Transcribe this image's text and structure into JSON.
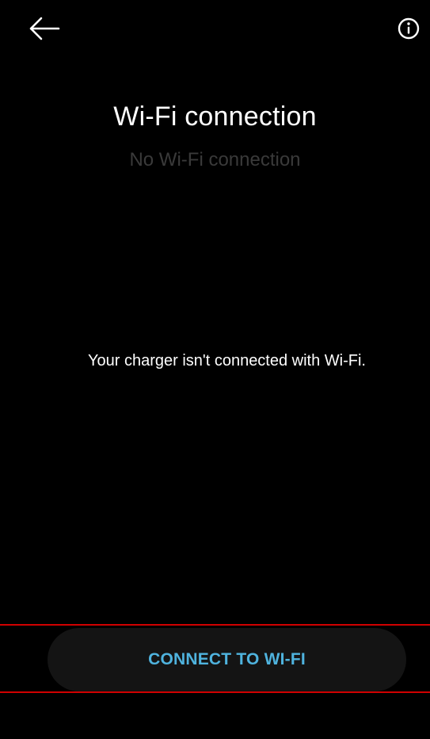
{
  "header": {
    "back_icon": "arrow-left-icon",
    "info_icon": "info-circle-icon"
  },
  "main": {
    "title": "Wi-Fi connection",
    "subtitle": "No Wi-Fi connection",
    "message": "Your charger isn't connected with Wi-Fi."
  },
  "footer": {
    "connect_button_label": "CONNECT TO WI-FI"
  },
  "colors": {
    "background": "#000000",
    "accent": "#4FB3DE",
    "button_background": "#141414",
    "frame_highlight": "#D00000"
  }
}
